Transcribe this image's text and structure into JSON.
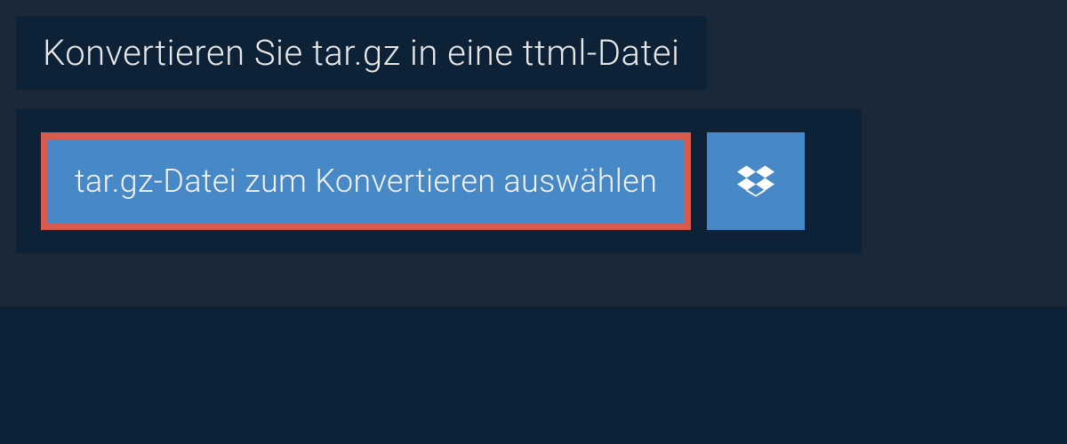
{
  "header": {
    "title": "Konvertieren Sie tar.gz in eine ttml-Datei"
  },
  "upload": {
    "select_label": "tar.gz-Datei zum Konvertieren auswählen",
    "dropbox_icon": "dropbox"
  }
}
